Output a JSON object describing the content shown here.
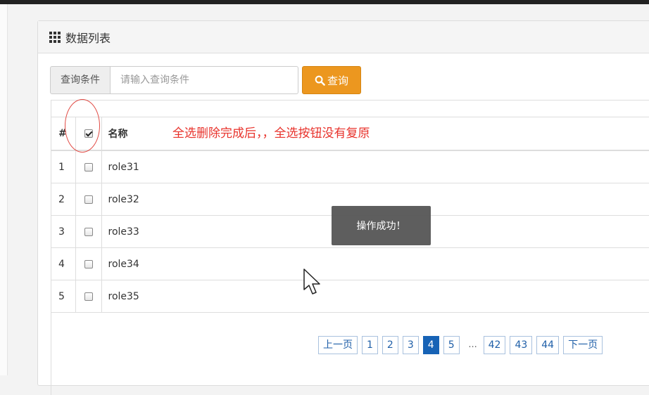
{
  "panel": {
    "title": "数据列表"
  },
  "search": {
    "addon_label": "查询条件",
    "placeholder": "请输入查询条件",
    "button_label": "查询"
  },
  "table": {
    "headers": {
      "num": "#",
      "name": "名称"
    },
    "header_checkbox_checked": true,
    "rows": [
      {
        "num": "1",
        "name": "role31",
        "checked": false
      },
      {
        "num": "2",
        "name": "role32",
        "checked": false
      },
      {
        "num": "3",
        "name": "role33",
        "checked": false
      },
      {
        "num": "4",
        "name": "role34",
        "checked": false
      },
      {
        "num": "5",
        "name": "role35",
        "checked": false
      }
    ]
  },
  "annotation": {
    "text": "全选删除完成后，，全选按钮没有复原"
  },
  "toast": {
    "text": "操作成功！"
  },
  "pagination": {
    "prev": "上一页",
    "next": "下一页",
    "pages_before": [
      "1",
      "2",
      "3"
    ],
    "current": "4",
    "after_current": [
      "5"
    ],
    "ellipsis": "...",
    "pages_end": [
      "42",
      "43",
      "44"
    ]
  },
  "colors": {
    "search_button": "#ec971f",
    "active_page": "#1763b6",
    "annotation": "#e8322b"
  }
}
